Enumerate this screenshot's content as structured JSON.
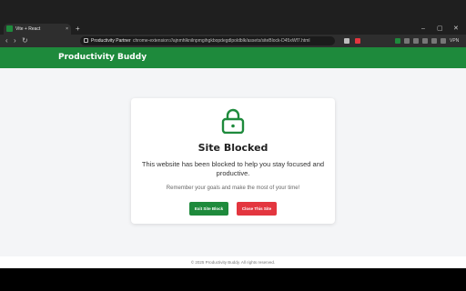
{
  "browser": {
    "tab_title": "Vite + React",
    "tab_close": "×",
    "new_tab": "+",
    "controls": {
      "minimize": "–",
      "maximize": "▢",
      "close": "✕"
    },
    "nav": {
      "back": "‹",
      "forward": "›",
      "reload": "↻"
    },
    "site_name": "Productivity Partner",
    "url": "chrome-extension://ajnmhlknilnpmgihgkbopdegdlpoldblk/assets/siteBlock-D45xWf7.html",
    "zoom": "VPN"
  },
  "header": {
    "brand": "Productivity Buddy"
  },
  "card": {
    "title": "Site Blocked",
    "message": "This website has been blocked to help you stay focused and productive.",
    "note": "Remember your goals and make the most of your time!",
    "exit_label": "Exit Site Block",
    "close_label": "Close This Site"
  },
  "footer": {
    "text": "© 2025 Productivity Buddy. All rights reserved."
  },
  "colors": {
    "brand_green": "#1e8a3c",
    "close_red": "#e3363f"
  }
}
